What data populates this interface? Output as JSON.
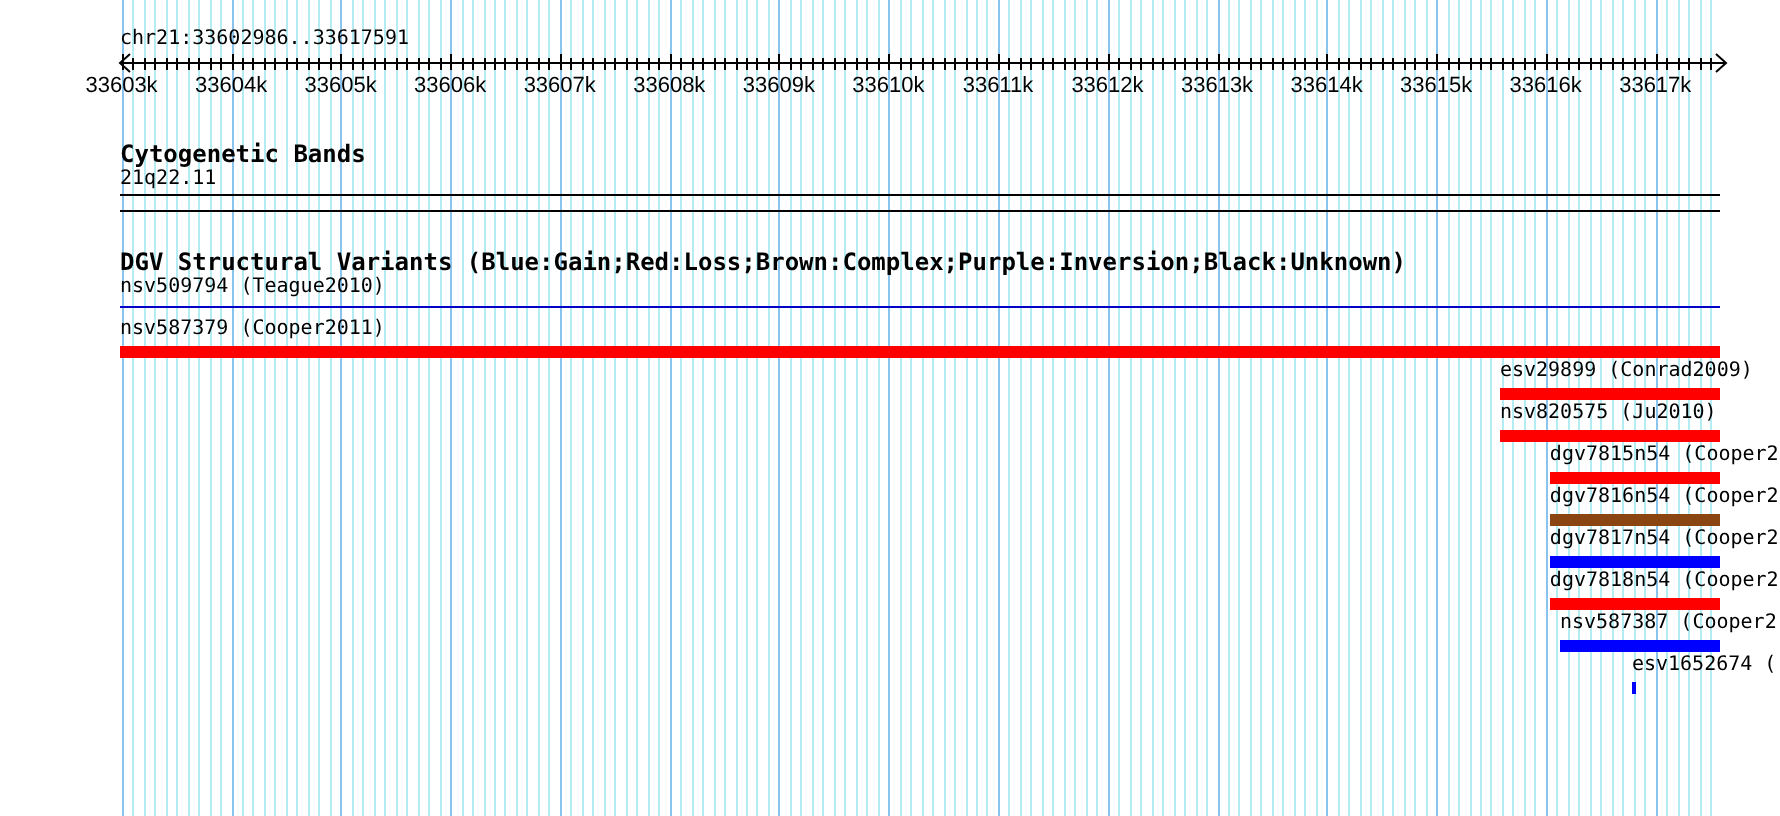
{
  "ruler": {
    "region": "chr21:33602986..33617591",
    "ticks": [
      "33603k",
      "33604k",
      "33605k",
      "33606k",
      "33607k",
      "33608k",
      "33609k",
      "33610k",
      "33611k",
      "33612k",
      "33613k",
      "33614k",
      "33615k",
      "33616k",
      "33617k"
    ]
  },
  "tracks": [
    {
      "title": "Cytogenetic Bands",
      "features": [
        {
          "label": "21q22.11",
          "kind": "band",
          "color": "#000000"
        }
      ]
    },
    {
      "title": "DGV Structural Variants (Blue:Gain;Red:Loss;Brown:Complex;Purple:Inversion;Black:Unknown)",
      "features": [
        {
          "label": "nsv509794 (Teague2010)",
          "kind": "line",
          "color": "#0000c8"
        },
        {
          "label": "nsv587379 (Cooper2011)",
          "kind": "bar",
          "color": "#ff0000"
        },
        {
          "label": "esv29899 (Conrad2009)",
          "kind": "bar",
          "color": "#ff0000"
        },
        {
          "label": "nsv820575 (Ju2010)",
          "kind": "bar",
          "color": "#ff0000"
        },
        {
          "label": "dgv7815n54 (Cooper2",
          "kind": "bar",
          "color": "#ff0000"
        },
        {
          "label": "dgv7816n54 (Cooper2",
          "kind": "bar",
          "color": "#8b4513"
        },
        {
          "label": "dgv7817n54 (Cooper2",
          "kind": "bar",
          "color": "#0000ff"
        },
        {
          "label": "dgv7818n54 (Cooper2",
          "kind": "bar",
          "color": "#ff0000"
        },
        {
          "label": "nsv587387 (Cooper2",
          "kind": "bar",
          "color": "#0000ff"
        },
        {
          "label": "esv1652674 (",
          "kind": "bar",
          "color": "#0000ff"
        }
      ]
    }
  ]
}
